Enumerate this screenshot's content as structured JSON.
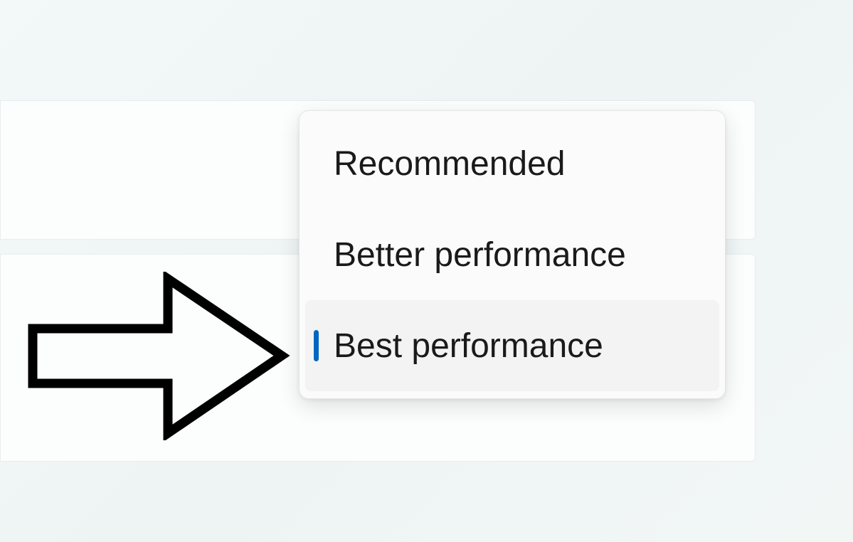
{
  "menu": {
    "items": [
      {
        "label": "Recommended",
        "selected": false
      },
      {
        "label": "Better performance",
        "selected": false
      },
      {
        "label": "Best performance",
        "selected": true
      }
    ]
  },
  "colors": {
    "accent": "#0067c0",
    "menuBg": "#fbfbfb",
    "selectedBg": "#f3f3f3"
  },
  "annotation": {
    "arrow": "pointing-right"
  }
}
